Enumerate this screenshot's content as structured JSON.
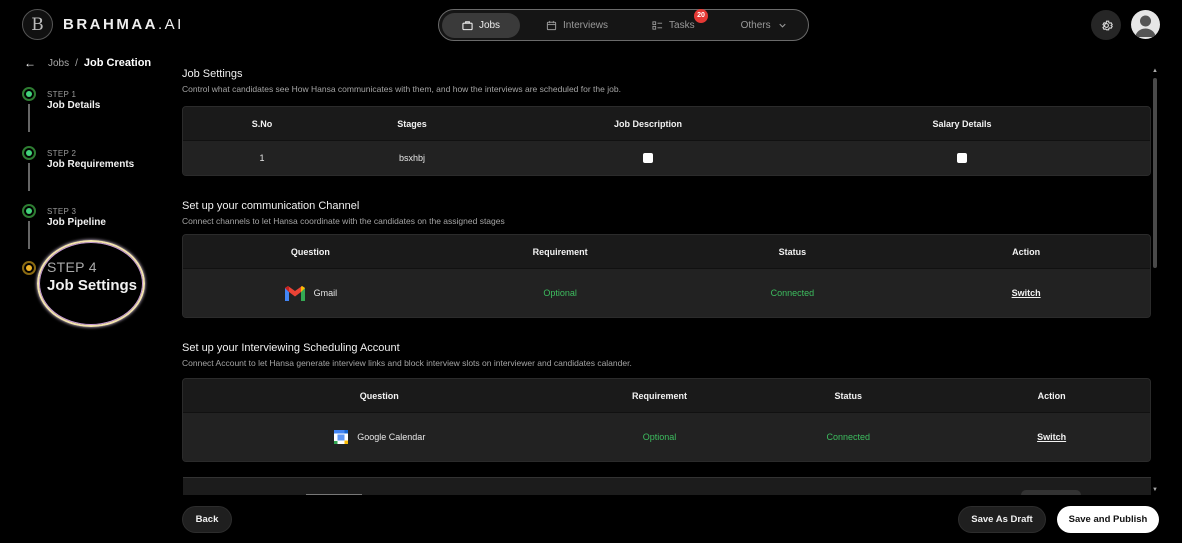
{
  "brand": {
    "logo_letter": "B",
    "name_bold": "BRAHMAA",
    "name_thin": ".AI"
  },
  "nav": {
    "items": [
      {
        "label": "Jobs",
        "icon": "briefcase-icon",
        "active": true
      },
      {
        "label": "Interviews",
        "icon": "calendar-icon"
      },
      {
        "label": "Tasks",
        "icon": "tasks-icon",
        "badge": "20"
      },
      {
        "label": "Others",
        "icon": "chevron-down-icon"
      }
    ]
  },
  "breadcrumb": {
    "parent": "Jobs",
    "separator": "/",
    "current": "Job Creation"
  },
  "steps": [
    {
      "num": "STEP 1",
      "title": "Job Details",
      "status": "done"
    },
    {
      "num": "STEP 2",
      "title": "Job Requirements",
      "status": "done"
    },
    {
      "num": "STEP 3",
      "title": "Job Pipeline",
      "status": "done"
    },
    {
      "num": "STEP 4",
      "title": "Job Settings",
      "status": "current"
    }
  ],
  "job_settings": {
    "title": "Job Settings",
    "subtitle": "Control what candidates see How Hansa communicates with them, and how the interviews are scheduled for the job.",
    "columns": [
      "S.No",
      "Stages",
      "Job Description",
      "Salary Details"
    ],
    "rows": [
      {
        "sno": "1",
        "stage": "bsxhbj",
        "job_description": true,
        "salary_details": true
      }
    ]
  },
  "communication": {
    "title": "Set up your communication Channel",
    "subtitle": "Connect channels to let Hansa coordinate with the candidates on the assigned stages",
    "columns": [
      "Question",
      "Requirement",
      "Status",
      "Action"
    ],
    "rows": [
      {
        "question": "Gmail",
        "icon": "gmail-icon",
        "requirement": "Optional",
        "status": "Connected",
        "action": "Switch"
      }
    ]
  },
  "scheduling": {
    "title": "Set up your Interviewing Scheduling Account",
    "subtitle": "Connect Account to let Hansa generate interview links and block interview slots on interviewer and candidates calander.",
    "columns": [
      "Question",
      "Requirement",
      "Status",
      "Action"
    ],
    "rows": [
      {
        "question": "Google Calendar",
        "icon": "google-calendar-icon",
        "requirement": "Optional",
        "status": "Connected",
        "action": "Switch"
      }
    ]
  },
  "footer": {
    "back": "Back",
    "draft": "Save As Draft",
    "publish": "Save and Publish"
  },
  "colors": {
    "accent_green": "#3dbd5f",
    "step_done": "#43d17a",
    "step_current": "#f0b429",
    "badge": "#e53935"
  }
}
